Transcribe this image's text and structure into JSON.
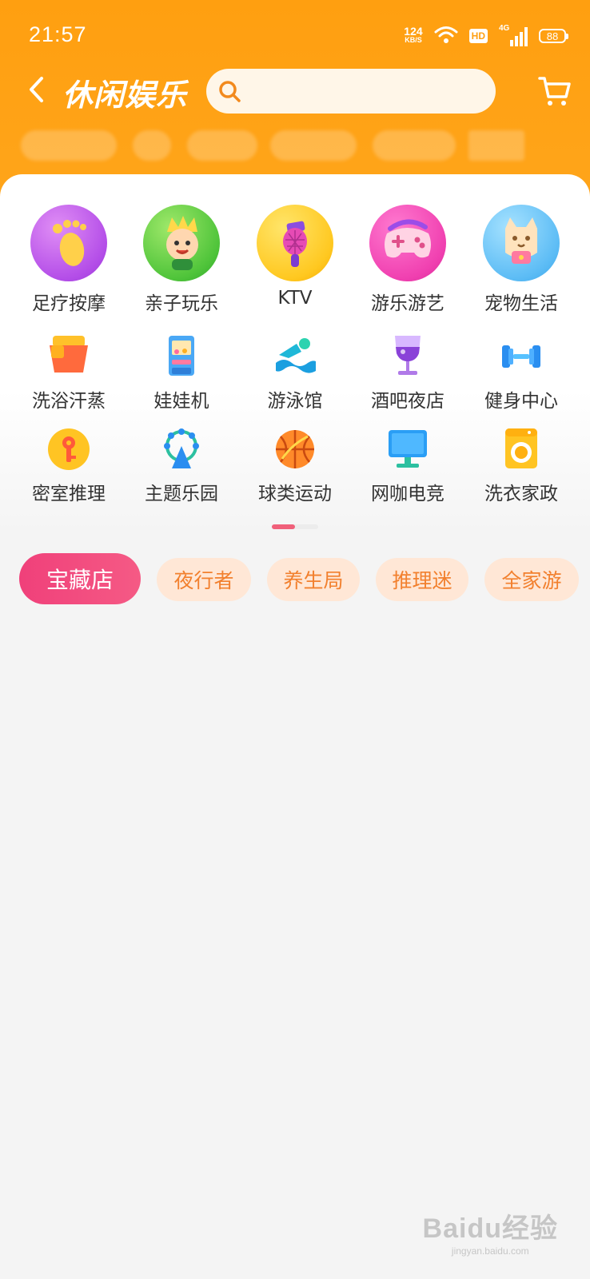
{
  "status_bar": {
    "time": "21:57",
    "net_speed_value": "124",
    "net_speed_unit": "KB/S",
    "hd_label": "HD",
    "network_label": "4G",
    "battery": "88"
  },
  "header": {
    "title": "休闲娱乐",
    "search_placeholder": "",
    "search_value": ""
  },
  "categories": [
    {
      "label": "足疗按摩",
      "icon": "foot-icon"
    },
    {
      "label": "亲子玩乐",
      "icon": "kid-face-icon"
    },
    {
      "label": "KTV",
      "icon": "microphone-icon"
    },
    {
      "label": "游乐游艺",
      "icon": "gamepad-icon"
    },
    {
      "label": "宠物生活",
      "icon": "cat-icon"
    },
    {
      "label": "洗浴汗蒸",
      "icon": "bath-icon"
    },
    {
      "label": "娃娃机",
      "icon": "claw-machine-icon"
    },
    {
      "label": "游泳馆",
      "icon": "swimmer-icon"
    },
    {
      "label": "酒吧夜店",
      "icon": "wine-glass-icon"
    },
    {
      "label": "健身中心",
      "icon": "dumbbell-icon"
    },
    {
      "label": "密室推理",
      "icon": "key-icon"
    },
    {
      "label": "主题乐园",
      "icon": "ferris-wheel-icon"
    },
    {
      "label": "球类运动",
      "icon": "basketball-icon"
    },
    {
      "label": "网咖电竞",
      "icon": "monitor-icon"
    },
    {
      "label": "洗衣家政",
      "icon": "washing-machine-icon"
    }
  ],
  "pager": {
    "current_page": 1,
    "total_pages": 2
  },
  "tags": [
    {
      "label": "宝藏店",
      "active": true
    },
    {
      "label": "夜行者",
      "active": false
    },
    {
      "label": "养生局",
      "active": false
    },
    {
      "label": "推理迷",
      "active": false
    },
    {
      "label": "全家游",
      "active": false
    }
  ],
  "watermark": {
    "logo": "Baidu经验",
    "url": "jingyan.baidu.com"
  },
  "colors": {
    "header_orange": "#ffa012",
    "active_tag": "#f0407a",
    "tag_bg": "#ffe7d6",
    "tag_text": "#f2802e"
  }
}
